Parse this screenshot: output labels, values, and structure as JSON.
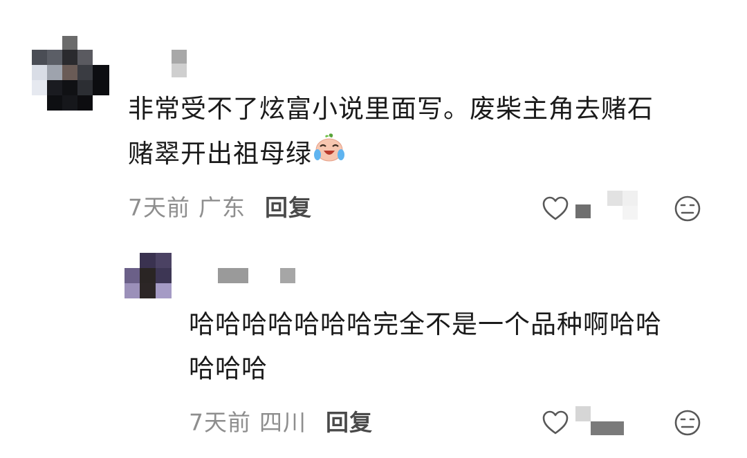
{
  "comment": {
    "text_line1": "非常受不了炫富小说里面写。废柴主角去赌石",
    "text_line2": "赌翠开出祖母绿",
    "emoji": "crying-laughing-peach-emoji",
    "time": "7天前",
    "location": "广东",
    "reply_label": "回复"
  },
  "reply": {
    "text_line1": "哈哈哈哈哈哈哈完全不是一个品种啊哈哈",
    "text_line2": "哈哈哈",
    "time": "7天前",
    "location": "四川",
    "reply_label": "回复"
  },
  "colors": {
    "meta_gray": "#8e8e8e",
    "reply_label": "#4a4a4a",
    "body_text": "#1a1a1a"
  }
}
